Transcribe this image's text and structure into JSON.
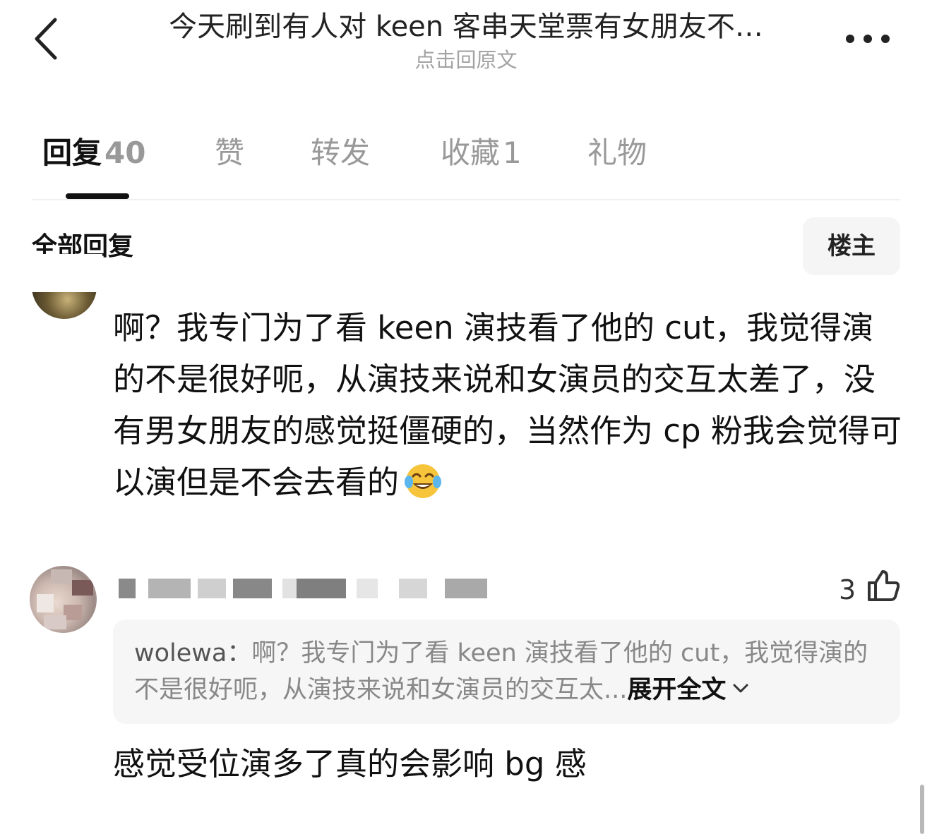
{
  "header": {
    "title": "今天刷到有人对 keen 客串天堂票有女朋友不…",
    "subtitle": "点击回原文",
    "back_icon": "chevron-left-icon",
    "more_icon": "more-horizontal-icon"
  },
  "tabs": [
    {
      "label": "回复",
      "count": "40",
      "active": true
    },
    {
      "label": "赞",
      "count": ""
    },
    {
      "label": "转发",
      "count": ""
    },
    {
      "label": "收藏",
      "count": "1"
    },
    {
      "label": "礼物",
      "count": ""
    }
  ],
  "section": {
    "title": "全部回复",
    "filter_button": "楼主"
  },
  "replies": [
    {
      "text": "啊？我专门为了看 keen 演技看了他的 cut，我觉得演的不是很好呃，从演技来说和女演员的交互太差了，没有男女朋友的感觉挺僵硬的，当然作为 cp 粉我会觉得可以演但是不会去看的",
      "emoji": "face-with-tears-of-joy-emoji"
    },
    {
      "likes": "3",
      "like_icon": "thumbs-up-icon",
      "quote": {
        "user": "wolewa：",
        "text": "啊？我专门为了看 keen 演技看了他的 cut，我觉得演的不是很好呃，从演技来说和女演员的交互太...",
        "expand": "展开全文"
      },
      "text": "感觉受位演多了真的会影响 bg 感"
    }
  ]
}
